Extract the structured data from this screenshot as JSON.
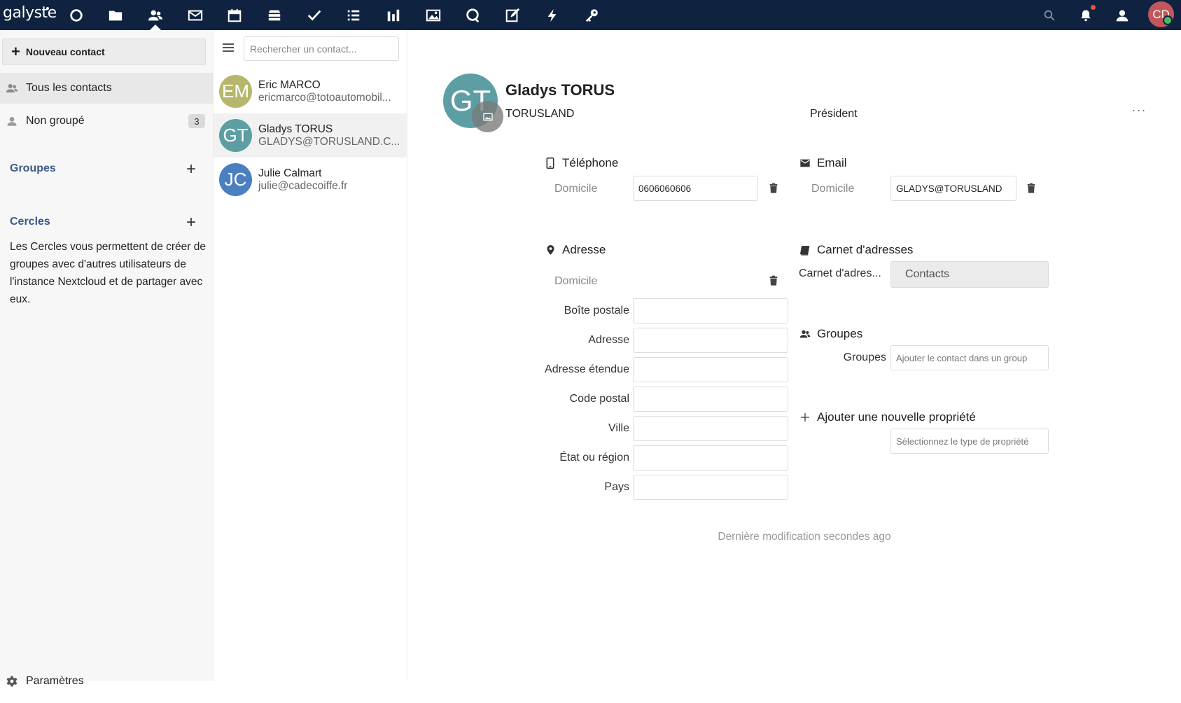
{
  "topbar": {
    "logo_text": "galyste",
    "apps": [
      {
        "name": "dashboard-icon"
      },
      {
        "name": "files-icon"
      },
      {
        "name": "contacts-icon"
      },
      {
        "name": "mail-icon"
      },
      {
        "name": "calendar-icon"
      },
      {
        "name": "deck-icon"
      },
      {
        "name": "tasks-icon"
      },
      {
        "name": "list-icon"
      },
      {
        "name": "analytics-icon"
      },
      {
        "name": "photos-icon"
      },
      {
        "name": "talk-icon"
      },
      {
        "name": "notes-icon"
      },
      {
        "name": "activity-icon"
      },
      {
        "name": "passwords-icon"
      }
    ],
    "user_initials": "CD",
    "accent": "#0f2341"
  },
  "left_nav": {
    "new_contact": "Nouveau contact",
    "items": [
      {
        "label": "Tous les contacts"
      },
      {
        "label": "Non groupé",
        "count": "3"
      }
    ],
    "groups_title": "Groupes",
    "circles_title": "Cercles",
    "circles_desc": "Les Cercles vous permettent de créer de groupes avec d'autres utilisateurs de l'instance Nextcloud et de partager avec eux.",
    "settings": "Paramètres"
  },
  "contact_list": {
    "search_placeholder": "Rechercher un contact...",
    "contacts": [
      {
        "initials": "EM",
        "name": "Eric MARCO",
        "sub": "ericmarco@totoautomobil...",
        "color": "#b6b76c"
      },
      {
        "initials": "GT",
        "name": "Gladys TORUS",
        "sub": "GLADYS@TORUSLAND.C...",
        "color": "#5c9ea4",
        "selected": true
      },
      {
        "initials": "JC",
        "name": "Julie Calmart",
        "sub": "julie@cadecoiffe.fr",
        "color": "#4a7fc1"
      }
    ]
  },
  "detail": {
    "initials": "GT",
    "name": "Gladys TORUS",
    "org": "TORUSLAND",
    "title": "Président",
    "more": "···",
    "phone": {
      "heading": "Téléphone",
      "type": "Domicile",
      "value": "0606060606"
    },
    "email": {
      "heading": "Email",
      "type": "Domicile",
      "value": "GLADYS@TORUSLAND"
    },
    "address": {
      "heading": "Adresse",
      "type": "Domicile",
      "fields": [
        {
          "label": "Boîte postale",
          "value": ""
        },
        {
          "label": "Adresse",
          "value": ""
        },
        {
          "label": "Adresse étendue",
          "value": ""
        },
        {
          "label": "Code postal",
          "value": ""
        },
        {
          "label": "Ville",
          "value": ""
        },
        {
          "label": "État ou région",
          "value": ""
        },
        {
          "label": "Pays",
          "value": ""
        }
      ]
    },
    "addressbook": {
      "heading": "Carnet d'adresses",
      "label": "Carnet d'adres...",
      "value": "Contacts"
    },
    "groups": {
      "heading": "Groupes",
      "label": "Groupes",
      "placeholder": "Ajouter le contact dans un group"
    },
    "new_property": {
      "heading": "Ajouter une nouvelle propriété",
      "placeholder": "Sélectionnez le type de propriété"
    },
    "last_modified": "Dernière modification secondes ago"
  }
}
